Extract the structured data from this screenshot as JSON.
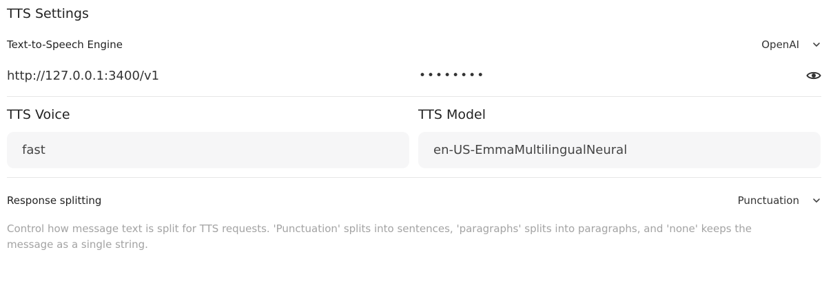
{
  "section": {
    "title": "TTS Settings"
  },
  "engine": {
    "label": "Text-to-Speech Engine",
    "selected": "OpenAI"
  },
  "credentials": {
    "base_url": "http://127.0.0.1:3400/v1",
    "api_key_masked": "••••••••"
  },
  "voice": {
    "label": "TTS Voice",
    "value": "fast"
  },
  "model": {
    "label": "TTS Model",
    "value": "en-US-EmmaMultilingualNeural"
  },
  "response_splitting": {
    "label": "Response splitting",
    "selected": "Punctuation",
    "help": "Control how message text is split for TTS requests. 'Punctuation' splits into sentences, 'paragraphs' splits into paragraphs, and 'none' keeps the message as a single string."
  }
}
